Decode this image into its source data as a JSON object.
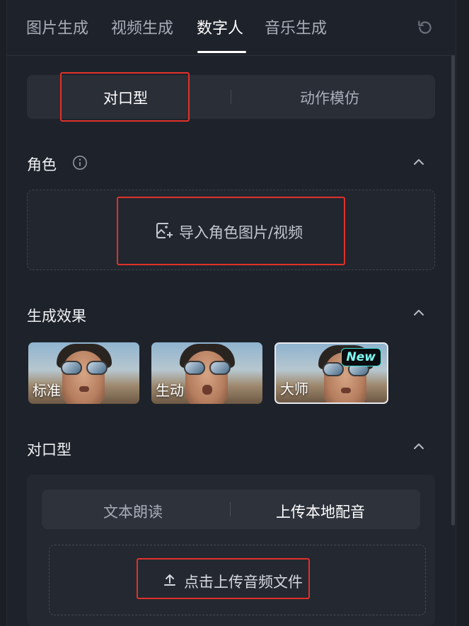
{
  "tabs": [
    {
      "label": "图片生成",
      "active": false
    },
    {
      "label": "视频生成",
      "active": false
    },
    {
      "label": "数字人",
      "active": true
    },
    {
      "label": "音乐生成",
      "active": false
    }
  ],
  "mode_switch": {
    "left": "对口型",
    "right": "动作模仿",
    "selected": "对口型"
  },
  "role_section": {
    "title": "角色",
    "upload_label": "导入角色图片/视频"
  },
  "effect_section": {
    "title": "生成效果",
    "options": [
      {
        "label": "标准",
        "selected": false
      },
      {
        "label": "生动",
        "selected": false
      },
      {
        "label": "大师",
        "selected": true,
        "badge": "New"
      }
    ]
  },
  "lipsync_section": {
    "title": "对口型",
    "source_switch": {
      "left": "文本朗读",
      "right": "上传本地配音",
      "selected": "上传本地配音"
    },
    "upload_label": "点击上传音频文件"
  },
  "colors": {
    "background": "#1e222a",
    "highlight": "#e0312a",
    "active_text": "#ffffff",
    "muted_text": "#a8adb8",
    "badge_text": "#7ef7f0"
  }
}
